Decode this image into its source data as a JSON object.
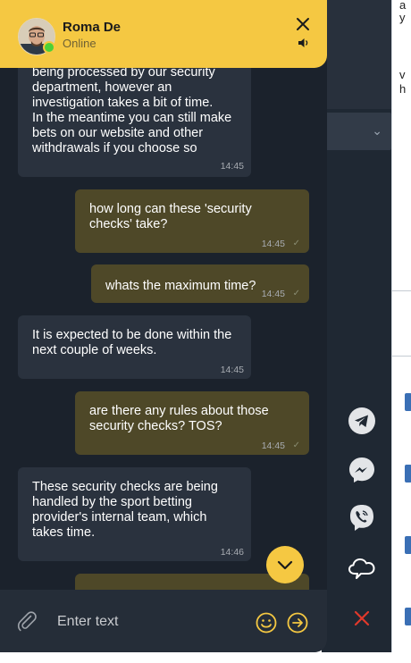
{
  "header": {
    "agent_name": "Roma De",
    "agent_status": "Online"
  },
  "messages": [
    {
      "dir": "in",
      "text": "being processed by our security\ndepartment, however an\ninvestigation takes a bit of time.\nIn the meantime you can still make\nbets on our website and other\nwithdrawals if you choose so",
      "time": "14:45"
    },
    {
      "dir": "out",
      "text": "how long can these 'security\nchecks' take?",
      "time": "14:45"
    },
    {
      "dir": "out",
      "text": "whats the maximum time?",
      "time": "14:45"
    },
    {
      "dir": "in",
      "text": "It is expected to be done within the\nnext couple of weeks.",
      "time": "14:45"
    },
    {
      "dir": "out",
      "text": "are there any rules about those\nsecurity checks? TOS?",
      "time": "14:45"
    },
    {
      "dir": "in",
      "text": "These security checks are being\nhandled by the sport betting\nprovider's internal team, which\ntakes time.",
      "time": "14:46"
    },
    {
      "dir": "out",
      "text": "",
      "time": ""
    }
  ],
  "composer": {
    "placeholder": "Enter text"
  },
  "background": {
    "right_snippets": [
      "a",
      "y",
      "v",
      "h"
    ]
  },
  "colors": {
    "header": "#f5c842",
    "chat_bg": "#1b222c",
    "incoming_bubble": "#2a323e",
    "outgoing_bubble": "#4e4828",
    "online": "#4cd137",
    "close_red": "#e0392b"
  },
  "icons": {
    "side": [
      "telegram-icon",
      "messenger-icon",
      "viber-icon",
      "chat-cloud-icon",
      "close-x-icon"
    ]
  }
}
